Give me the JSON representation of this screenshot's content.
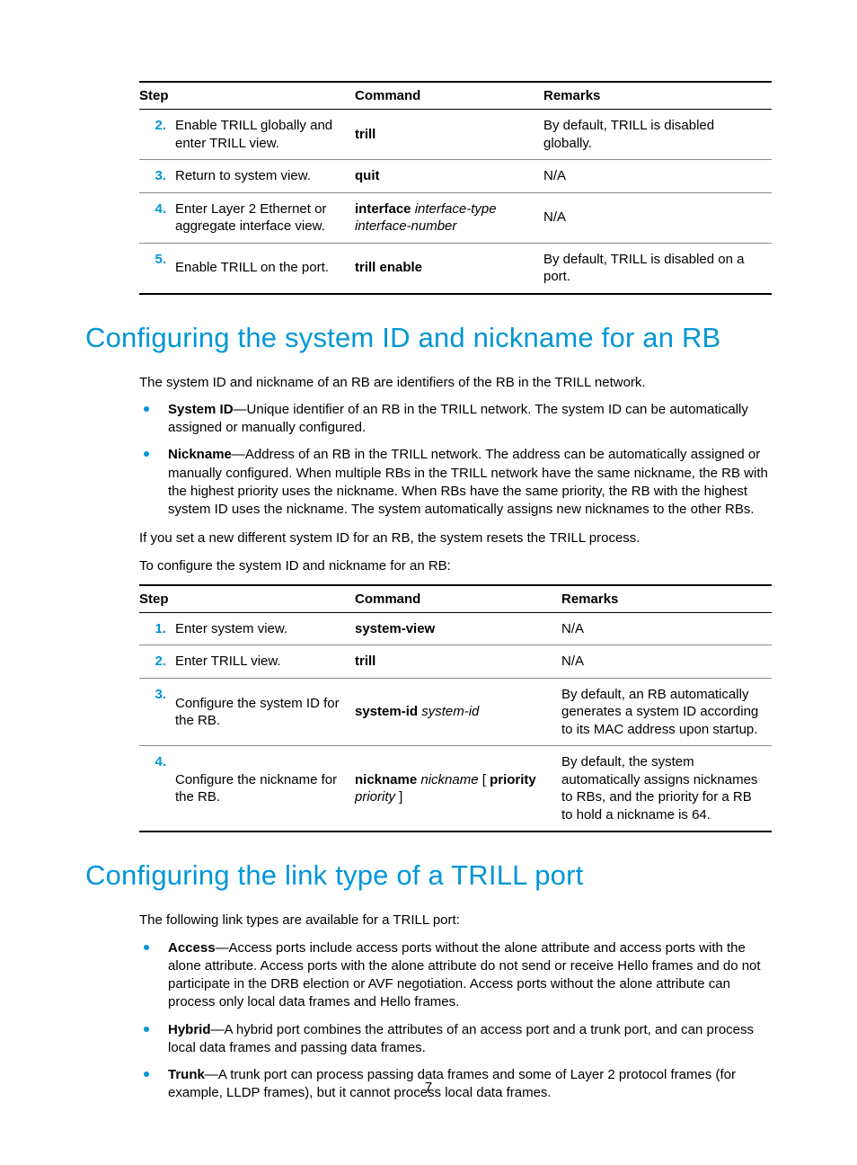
{
  "page_number": "7",
  "table1": {
    "headers": [
      "Step",
      "Command",
      "Remarks"
    ],
    "rows": [
      {
        "num": "2.",
        "step": "Enable TRILL globally and enter TRILL view.",
        "cmd": [
          {
            "t": "trill",
            "bold": true
          }
        ],
        "remarks": "By default, TRILL is disabled globally."
      },
      {
        "num": "3.",
        "step": "Return to system view.",
        "cmd": [
          {
            "t": "quit",
            "bold": true
          }
        ],
        "remarks": "N/A"
      },
      {
        "num": "4.",
        "step": "Enter Layer 2 Ethernet or aggregate interface view.",
        "cmd": [
          {
            "t": "interface",
            "bold": true
          },
          {
            "t": " interface-type interface-number",
            "italic": true
          }
        ],
        "remarks": "N/A"
      },
      {
        "num": "5.",
        "step": "Enable TRILL on the port.",
        "cmd": [
          {
            "t": "trill enable",
            "bold": true
          }
        ],
        "remarks": "By default, TRILL is disabled on a port."
      }
    ]
  },
  "section1": {
    "title": "Configuring the system ID and nickname for an RB",
    "intro": "The system ID and nickname of an RB are identifiers of the RB in the TRILL network.",
    "bullets": [
      {
        "label": "System ID",
        "text": "—Unique identifier of an RB in the TRILL network. The system ID can be automatically assigned or manually configured."
      },
      {
        "label": "Nickname",
        "text": "—Address of an RB in the TRILL network. The address can be automatically assigned or manually configured. When multiple RBs in the TRILL network have the same nickname, the RB with the highest priority uses the nickname. When RBs have the same priority, the RB with the highest system ID uses the nickname. The system automatically assigns new nicknames to the other RBs."
      }
    ],
    "p2": "If you set a new different system ID for an RB, the system resets the TRILL process.",
    "p3": "To configure the system ID and nickname for an RB:"
  },
  "table2": {
    "headers": [
      "Step",
      "Command",
      "Remarks"
    ],
    "rows": [
      {
        "num": "1.",
        "step": "Enter system view.",
        "cmd": [
          {
            "t": "system-view",
            "bold": true
          }
        ],
        "remarks": "N/A"
      },
      {
        "num": "2.",
        "step": "Enter TRILL view.",
        "cmd": [
          {
            "t": "trill",
            "bold": true
          }
        ],
        "remarks": "N/A"
      },
      {
        "num": "3.",
        "step": "Configure the system ID for the RB.",
        "cmd": [
          {
            "t": "system-id",
            "bold": true
          },
          {
            "t": " system-id",
            "italic": true
          }
        ],
        "remarks": "By default, an RB automatically generates a system ID according to its MAC address upon startup."
      },
      {
        "num": "4.",
        "step": "Configure the nickname for the RB.",
        "cmd": [
          {
            "t": "nickname",
            "bold": true
          },
          {
            "t": " nickname",
            "italic": true
          },
          {
            "t": " [ "
          },
          {
            "t": "priority",
            "bold": true
          },
          {
            "t": " priority",
            "italic": true
          },
          {
            "t": " ]"
          }
        ],
        "remarks": "By default, the system automatically assigns nicknames to RBs, and the priority for a RB to hold a nickname is 64."
      }
    ]
  },
  "section2": {
    "title": "Configuring the link type of a TRILL port",
    "intro": "The following link types are available for a TRILL port:",
    "bullets": [
      {
        "label": "Access",
        "text": "—Access ports include access ports without the alone attribute and access ports with the alone attribute. Access ports with the alone attribute do not send or receive Hello frames and do not participate in the DRB election or AVF negotiation. Access ports without the alone attribute can process only local data frames and Hello frames."
      },
      {
        "label": "Hybrid",
        "text": "—A hybrid port combines the attributes of an access port and a trunk port, and can process local data frames and passing data frames."
      },
      {
        "label": "Trunk",
        "text": "—A trunk port can process passing data frames and some of Layer 2 protocol frames (for example, LLDP frames), but it cannot process local data frames."
      }
    ]
  }
}
